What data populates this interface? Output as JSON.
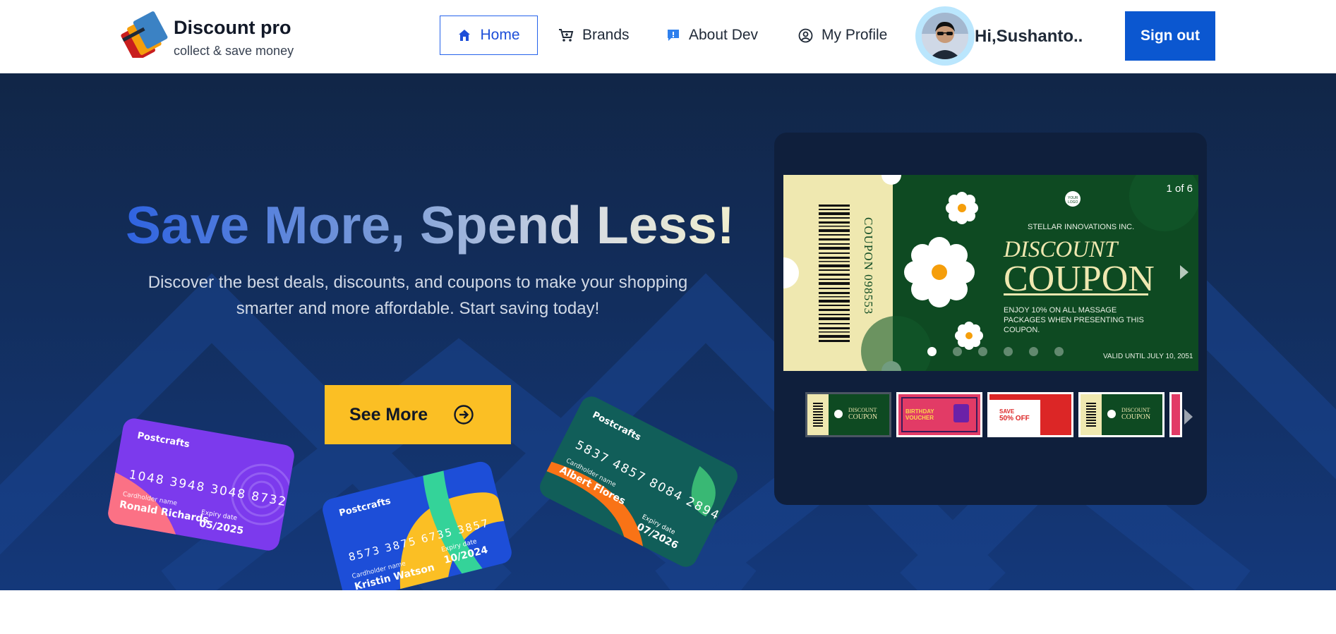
{
  "brand": {
    "name": "Discount pro",
    "tagline": "collect & save money"
  },
  "nav": {
    "items": [
      {
        "label": "Home",
        "icon": "home-icon",
        "active": true
      },
      {
        "label": "Brands",
        "icon": "cart-icon"
      },
      {
        "label": "About Dev",
        "icon": "info-chat-icon"
      },
      {
        "label": "My Profile",
        "icon": "user-circle-icon"
      }
    ],
    "greeting": "Hi,Sushanto..",
    "signout_label": "Sign out"
  },
  "hero": {
    "title": "Save More, Spend Less!",
    "subtitle_line1": "Discover the best deals, discounts, and coupons to make your shopping",
    "subtitle_line2": "smarter and more affordable. Start saving today!",
    "cta_label": "See More",
    "cards": [
      {
        "brand": "Postcrafts",
        "number": "1048  3948  3048  8732",
        "holder_label": "Cardholder name",
        "holder": "Ronald Richards",
        "expiry_label": "Expiry date",
        "expiry": "05/2025"
      },
      {
        "brand": "Postcrafts",
        "number": "8573  3875  6735  3857",
        "holder_label": "Cardholder name",
        "holder": "Kristin Watson",
        "expiry_label": "Expiry date",
        "expiry": "10/2024"
      },
      {
        "brand": "Postcrafts",
        "number": "5837  4857  8084  2894",
        "holder_label": "Cardholder name",
        "holder": "Albert Flores",
        "expiry_label": "Expiry date",
        "expiry": "07/2026"
      }
    ]
  },
  "carousel": {
    "counter": "1 of 6",
    "active_index": 0,
    "slide": {
      "stub_text": "COUPON 098553",
      "logo_text": "YOUR LOGO",
      "company": "STELLAR INNOVATIONS INC.",
      "heading_1": "DISCOUNT",
      "heading_2": "COUPON",
      "offer": "ENJOY 10% ON ALL MASSAGE PACKAGES WHEN PRESENTING THIS COUPON.",
      "valid": "VALID UNTIL JULY 10, 2051"
    },
    "thumbnails": [
      {
        "name": "discount-coupon-green",
        "l1": "DISCOUNT",
        "l2": "COUPON"
      },
      {
        "name": "birthday-voucher",
        "l1": "BIRTHDAY",
        "l2": "VOUCHER"
      },
      {
        "name": "save-50-off",
        "l1": "SAVE",
        "l2": "50% OFF"
      },
      {
        "name": "discount-coupon-green-2",
        "l1": "DISCOUNT",
        "l2": "COUPON"
      }
    ],
    "dots": 6
  },
  "colors": {
    "accent": "#0b57d0",
    "hero_bg": "#13294d",
    "cta": "#fbbf24",
    "coupon_green": "#0e4a22",
    "coupon_cream": "#efe8b0"
  }
}
